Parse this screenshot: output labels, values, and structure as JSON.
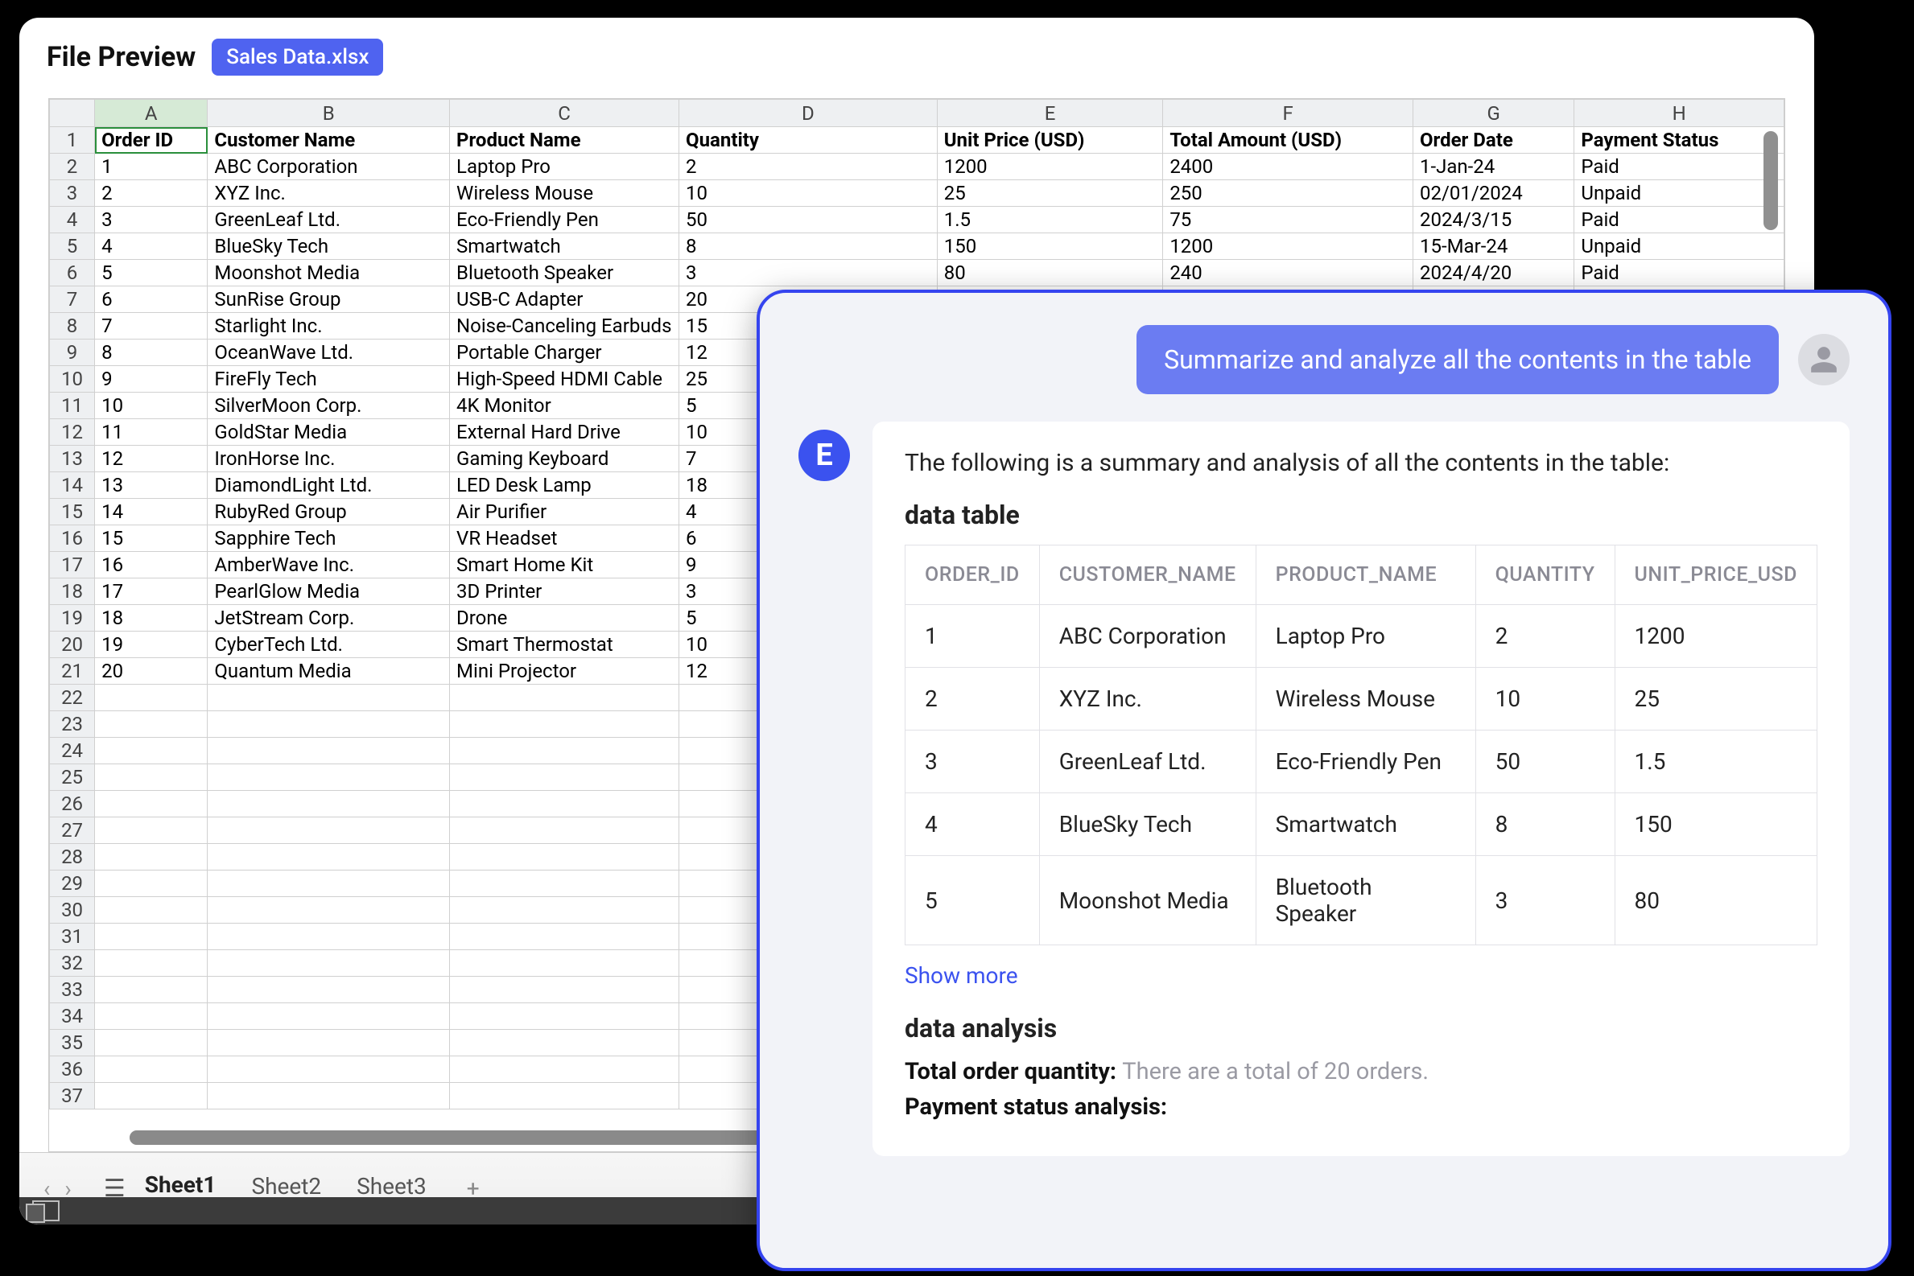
{
  "preview": {
    "title": "File Preview",
    "badge": "Sales Data.xlsx"
  },
  "sheet": {
    "columns": [
      "A",
      "B",
      "C",
      "D",
      "E",
      "F",
      "G",
      "H"
    ],
    "headers": [
      "Order ID",
      "Customer Name",
      "Product Name",
      "Quantity",
      "Unit Price (USD)",
      "Total Amount (USD)",
      "Order Date",
      "Payment Status"
    ],
    "rows": [
      [
        "1",
        "ABC Corporation",
        "Laptop Pro",
        "2",
        "1200",
        "2400",
        "1-Jan-24",
        "Paid"
      ],
      [
        "2",
        "XYZ Inc.",
        "Wireless Mouse",
        "10",
        "25",
        "250",
        "02/01/2024",
        "Unpaid"
      ],
      [
        "3",
        "GreenLeaf Ltd.",
        "Eco-Friendly Pen",
        "50",
        "1.5",
        "75",
        "2024/3/15",
        "Paid"
      ],
      [
        "4",
        "BlueSky Tech",
        "Smartwatch",
        "8",
        "150",
        "1200",
        "15-Mar-24",
        "Unpaid"
      ],
      [
        "5",
        "Moonshot Media",
        "Bluetooth Speaker",
        "3",
        "80",
        "240",
        "2024/4/20",
        "Paid"
      ],
      [
        "6",
        "SunRise Group",
        "USB-C Adapter",
        "20",
        "",
        "",
        "",
        ""
      ],
      [
        "7",
        "Starlight Inc.",
        "Noise-Canceling Earbuds",
        "15",
        "",
        "",
        "",
        ""
      ],
      [
        "8",
        "OceanWave Ltd.",
        "Portable Charger",
        "12",
        "",
        "",
        "",
        ""
      ],
      [
        "9",
        "FireFly Tech",
        "High-Speed HDMI Cable",
        "25",
        "",
        "",
        "",
        ""
      ],
      [
        "10",
        "SilverMoon Corp.",
        "4K Monitor",
        "5",
        "",
        "",
        "",
        ""
      ],
      [
        "11",
        "GoldStar Media",
        "External Hard Drive",
        "10",
        "",
        "",
        "",
        ""
      ],
      [
        "12",
        "IronHorse Inc.",
        "Gaming Keyboard",
        "7",
        "",
        "",
        "",
        ""
      ],
      [
        "13",
        "DiamondLight Ltd.",
        "LED Desk Lamp",
        "18",
        "",
        "",
        "",
        ""
      ],
      [
        "14",
        "RubyRed Group",
        "Air Purifier",
        "4",
        "",
        "",
        "",
        ""
      ],
      [
        "15",
        "Sapphire Tech",
        "VR Headset",
        "6",
        "",
        "",
        "",
        ""
      ],
      [
        "16",
        "AmberWave Inc.",
        "Smart Home Kit",
        "9",
        "",
        "",
        "",
        ""
      ],
      [
        "17",
        "PearlGlow Media",
        "3D Printer",
        "3",
        "",
        "",
        "",
        ""
      ],
      [
        "18",
        "JetStream Corp.",
        "Drone",
        "5",
        "",
        "",
        "",
        ""
      ],
      [
        "19",
        "CyberTech Ltd.",
        "Smart Thermostat",
        "10",
        "",
        "",
        "",
        ""
      ],
      [
        "20",
        "Quantum Media",
        "Mini Projector",
        "12",
        "",
        "",
        "",
        ""
      ]
    ],
    "blank_rows": 16,
    "tabs": [
      "Sheet1",
      "Sheet2",
      "Sheet3"
    ],
    "active_tab": 0
  },
  "chat": {
    "user_prompt": "Summarize and analyze all the contents in the table",
    "assistant_icon": "E",
    "lead": "The following is a summary and analysis of all the contents in the table:",
    "section1_title": "data table",
    "table_headers": [
      "ORDER_ID",
      "CUSTOMER_NAME",
      "PRODUCT_NAME",
      "QUANTITY",
      "UNIT_PRICE_USD"
    ],
    "table_rows": [
      [
        "1",
        "ABC Corporation",
        "Laptop Pro",
        "2",
        "1200"
      ],
      [
        "2",
        "XYZ Inc.",
        "Wireless Mouse",
        "10",
        "25"
      ],
      [
        "3",
        "GreenLeaf Ltd.",
        "Eco-Friendly Pen",
        "50",
        "1.5"
      ],
      [
        "4",
        "BlueSky Tech",
        "Smartwatch",
        "8",
        "150"
      ],
      [
        "5",
        "Moonshot Media",
        "Bluetooth Speaker",
        "3",
        "80"
      ]
    ],
    "show_more": "Show more",
    "section2_title": "data analysis",
    "analysis": {
      "line1_label": "Total order quantity: ",
      "line1_value": "There are a total of 20 orders.",
      "line2_label": "Payment status analysis:"
    }
  }
}
